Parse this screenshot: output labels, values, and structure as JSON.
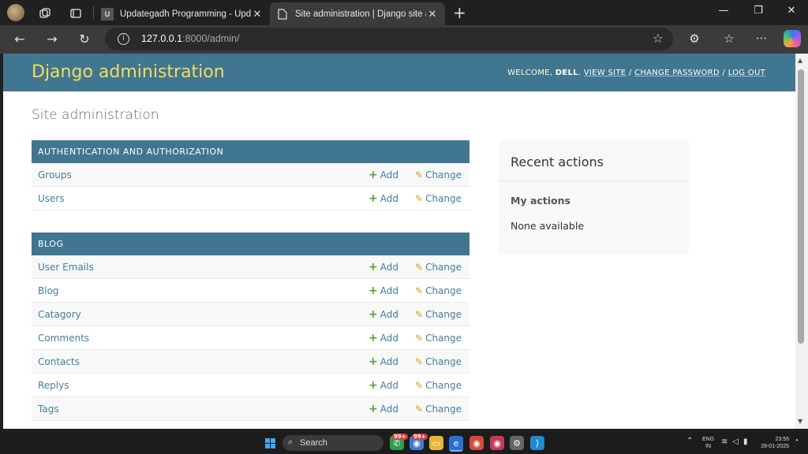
{
  "browser": {
    "tabs": [
      {
        "title": "Updategadh Programming - Upd",
        "favicon": "ug-favicon"
      },
      {
        "title": "Site administration | Django site a",
        "favicon": "page-icon"
      }
    ],
    "url_host": "127.0.0.1",
    "url_rest": ":8000/admin/"
  },
  "header": {
    "branding": "Django administration",
    "welcome": "WELCOME,",
    "username": "DELL",
    "view_site": "VIEW SITE",
    "change_password": "CHANGE PASSWORD",
    "log_out": "LOG OUT",
    "separator": "/"
  },
  "content": {
    "title": "Site administration",
    "add_label": "Add",
    "change_label": "Change",
    "apps": [
      {
        "caption": "AUTHENTICATION AND AUTHORIZATION",
        "models": [
          "Groups",
          "Users"
        ]
      },
      {
        "caption": "BLOG",
        "models": [
          "User Emails",
          "Blog",
          "Catagory",
          "Comments",
          "Contacts",
          "Replys",
          "Tags"
        ]
      }
    ]
  },
  "recent_actions": {
    "title": "Recent actions",
    "my_actions": "My actions",
    "none": "None available"
  },
  "taskbar": {
    "search": "Search",
    "badge": "99+",
    "lang": "ENG",
    "region": "IN",
    "time": "23:55",
    "date": "28-01-2025"
  },
  "colors": {
    "header_bg": "#417690",
    "branding": "#f5dd5d",
    "link": "#447e9b",
    "add_icon": "#5b9e3a",
    "change_icon": "#d4a017"
  }
}
